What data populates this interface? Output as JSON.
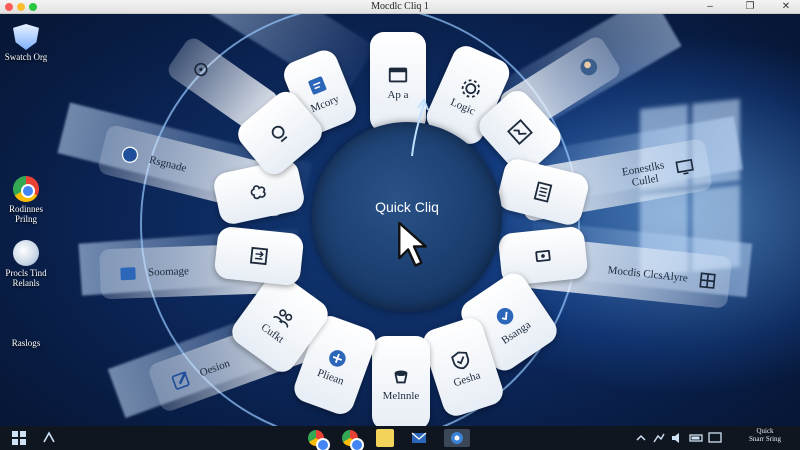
{
  "window": {
    "title": "Mocdlc Cliq 1"
  },
  "desktop_icons": [
    {
      "label": "Swatch Org"
    },
    {
      "label": "Rodinnes\nPrilng"
    },
    {
      "label": "Procls Tind\nRelanls"
    },
    {
      "label": "Raslogs"
    }
  ],
  "launcher": {
    "center_title": "Quick Cliq",
    "menu_items": [
      {
        "label": "Mcory",
        "icon": "note-icon"
      },
      {
        "label": "Ap a",
        "icon": "app-window-icon"
      },
      {
        "label": "Logic",
        "icon": "gear-icon"
      },
      {
        "label": "",
        "icon": "chart-icon"
      },
      {
        "label": "",
        "icon": "list-icon"
      },
      {
        "label": "",
        "icon": "display-icon"
      },
      {
        "label": "Bsanga",
        "icon": "check-circle-icon"
      },
      {
        "label": "Gesha",
        "icon": "shield-check-icon"
      },
      {
        "label": "Melnnle",
        "icon": "cup-icon"
      },
      {
        "label": "Pliean",
        "icon": "plus-badge-icon"
      },
      {
        "label": "Cufkt",
        "icon": "people-icon"
      },
      {
        "label": "",
        "icon": "swap-icon"
      },
      {
        "label": "",
        "icon": "brain-icon"
      },
      {
        "label": "",
        "icon": "search-icon"
      }
    ],
    "arms": [
      {
        "label": "",
        "icon": "settings-face-icon"
      },
      {
        "label": "Rsgnade",
        "icon": "globe-icon"
      },
      {
        "label": "Soomage",
        "icon": "folder-icon"
      },
      {
        "label": "Oesion",
        "icon": "edit-icon"
      },
      {
        "label": "",
        "icon": "user-icon"
      },
      {
        "label": "Eonestlks\nCullel",
        "icon": "monitor-icon"
      },
      {
        "label": "Mocdis ClcsAlyre",
        "icon": "grid-icon"
      }
    ]
  },
  "taskbar": {
    "tray_text": "Quick\nSnarr Sring"
  }
}
